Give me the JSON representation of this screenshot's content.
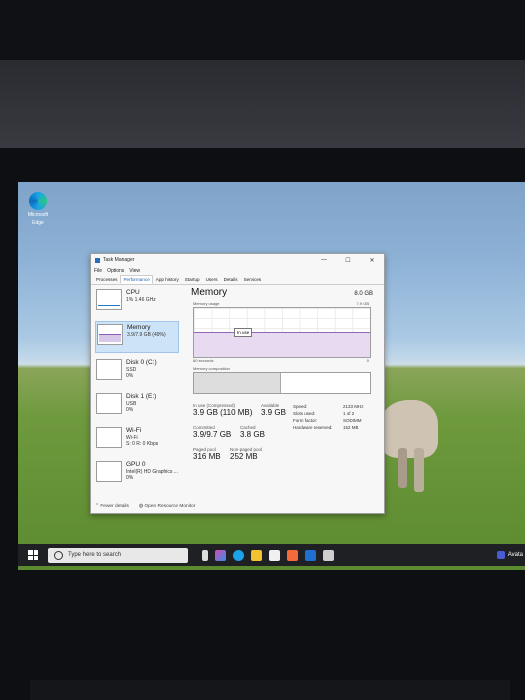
{
  "desktop": {
    "icon_label_1": "Microsoft",
    "icon_label_2": "Edge"
  },
  "window": {
    "title": "Task Manager",
    "minimize": "—",
    "maximize": "☐",
    "close": "✕"
  },
  "menu": [
    "File",
    "Options",
    "View"
  ],
  "tabs": [
    "Processes",
    "Performance",
    "App history",
    "Startup",
    "Users",
    "Details",
    "Services"
  ],
  "sidebar": [
    {
      "name": "CPU",
      "sub1": "1% 1.46 GHz",
      "sub2": ""
    },
    {
      "name": "Memory",
      "sub1": "3.9/7.9 GB (49%)",
      "sub2": ""
    },
    {
      "name": "Disk 0 (C:)",
      "sub1": "SSD",
      "sub2": "0%"
    },
    {
      "name": "Disk 1 (E:)",
      "sub1": "USB",
      "sub2": "0%"
    },
    {
      "name": "Wi-Fi",
      "sub1": "Wi-Fi",
      "sub2": "S: 0 R: 0 Kbps"
    },
    {
      "name": "GPU 0",
      "sub1": "Intel(R) HD Graphics ...",
      "sub2": "0%"
    }
  ],
  "memory": {
    "title": "Memory",
    "capacity": "8.0 GB",
    "usage_label": "Memory usage",
    "usage_max": "7.9 GB",
    "seconds": "60 seconds",
    "zero": "0",
    "tooltip": "In use",
    "composition": "Memory composition",
    "in_use_label": "In use (Compressed)",
    "in_use_value": "3.9 GB (110 MB)",
    "available_label": "Available",
    "available_value": "3.9 GB",
    "committed_label": "Committed",
    "committed_value": "3.9/9.7 GB",
    "cached_label": "Cached",
    "cached_value": "3.8 GB",
    "paged_label": "Paged pool",
    "paged_value": "316 MB",
    "nonpaged_label": "Non-paged pool",
    "nonpaged_value": "252 MB",
    "usage_fraction": 0.49
  },
  "hardware": [
    {
      "k": "Speed:",
      "v": "2133 MHz"
    },
    {
      "k": "Slots used:",
      "v": "1 of 2"
    },
    {
      "k": "Form factor:",
      "v": "SODIMM"
    },
    {
      "k": "Hardware reserved:",
      "v": "152 MB"
    }
  ],
  "footer": {
    "fewer": "Fewer details",
    "monitor": "Open Resource Monitor"
  },
  "taskbar": {
    "search_placeholder": "Type here to search",
    "tray_text": "Avata"
  }
}
